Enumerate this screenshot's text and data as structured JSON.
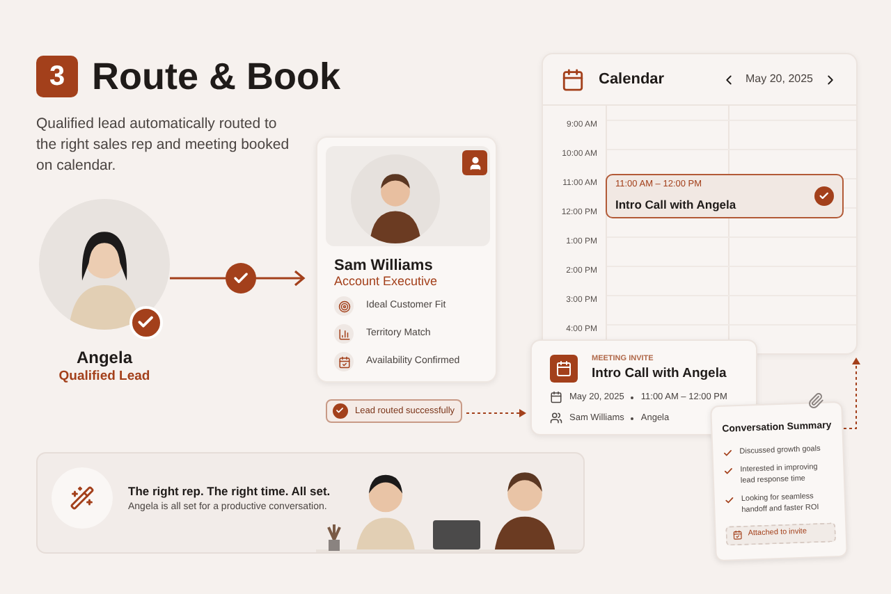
{
  "header": {
    "step": "3",
    "title": "Route & Book",
    "description": "Qualified lead automatically routed to the right sales rep and meeting booked on calendar."
  },
  "lead": {
    "name": "Angela",
    "role": "Qualified Lead",
    "verified": true
  },
  "routing": {
    "done": true
  },
  "rep": {
    "name": "Sam Williams",
    "role": "Account Executive",
    "criteria": [
      {
        "kind": "target",
        "label": "Ideal Customer Fit"
      },
      {
        "kind": "bars",
        "label": "Territory Match"
      },
      {
        "kind": "calendar",
        "label": "Availability Confirmed"
      }
    ]
  },
  "status_pill": {
    "label": "Lead routed successfully"
  },
  "calendar": {
    "title": "Calendar",
    "date": "May 20, 2025",
    "times": [
      "9:00 AM",
      "10:00 AM",
      "11:00 AM",
      "12:00 PM",
      "1:00 PM",
      "2:00 PM",
      "3:00 PM",
      "4:00 PM"
    ],
    "event": {
      "time": "11:00 AM – 12:00 PM",
      "title": "Intro Call with Angela",
      "confirmed": true
    }
  },
  "invite": {
    "eyebrow": "MEETING INVITE",
    "title": "Intro Call with Angela",
    "date": "May 20, 2025",
    "time": "11:00 AM – 12:00 PM",
    "host": "Sam Williams",
    "guest": "Angela"
  },
  "summary": {
    "title": "Conversation Summary",
    "points": [
      "Discussed growth goals",
      "Interested in improving lead response time",
      "Looking for seamless handoff and faster ROI"
    ],
    "attachment": "Attached to invite"
  },
  "banner": {
    "headline": "The right rep. The right time. All set.",
    "subtext": "Angela is all set for a productive conversation."
  }
}
